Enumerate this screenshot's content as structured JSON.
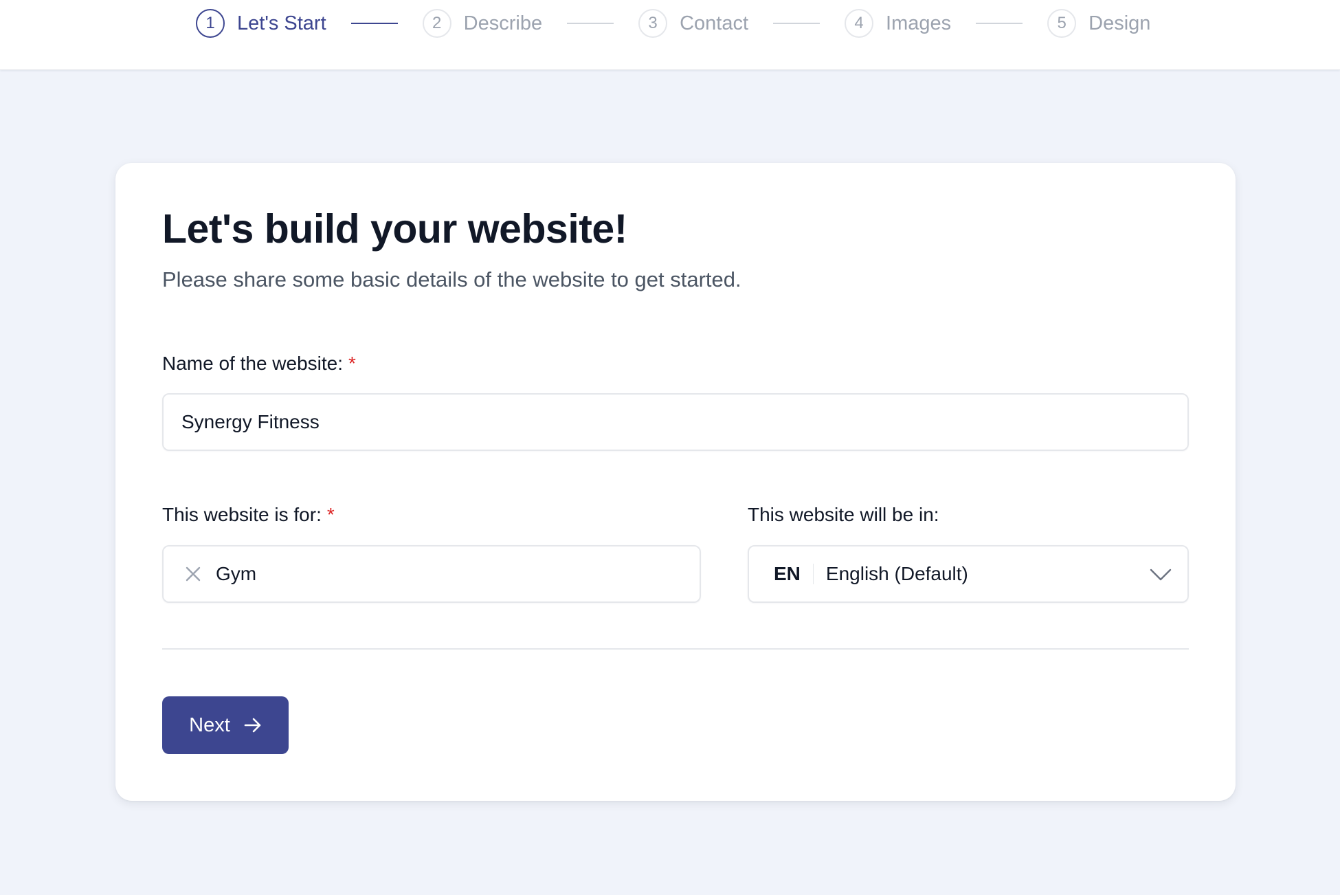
{
  "stepper": {
    "steps": [
      {
        "number": "1",
        "label": "Let's Start",
        "active": true
      },
      {
        "number": "2",
        "label": "Describe",
        "active": false
      },
      {
        "number": "3",
        "label": "Contact",
        "active": false
      },
      {
        "number": "4",
        "label": "Images",
        "active": false
      },
      {
        "number": "5",
        "label": "Design",
        "active": false
      }
    ]
  },
  "card": {
    "title": "Let's build your website!",
    "subtitle": "Please share some basic details of the website to get started."
  },
  "form": {
    "name_field": {
      "label": "Name of the website:",
      "required_mark": "*",
      "value": "Synergy Fitness"
    },
    "category_field": {
      "label": "This website is for:",
      "required_mark": "*",
      "value": "Gym"
    },
    "language_field": {
      "label": "This website will be in:",
      "code": "EN",
      "value": "English (Default)"
    },
    "next_button": {
      "label": "Next"
    }
  },
  "colors": {
    "accent": "#3d4690",
    "required": "#dc2626",
    "background": "#f0f3fa"
  }
}
